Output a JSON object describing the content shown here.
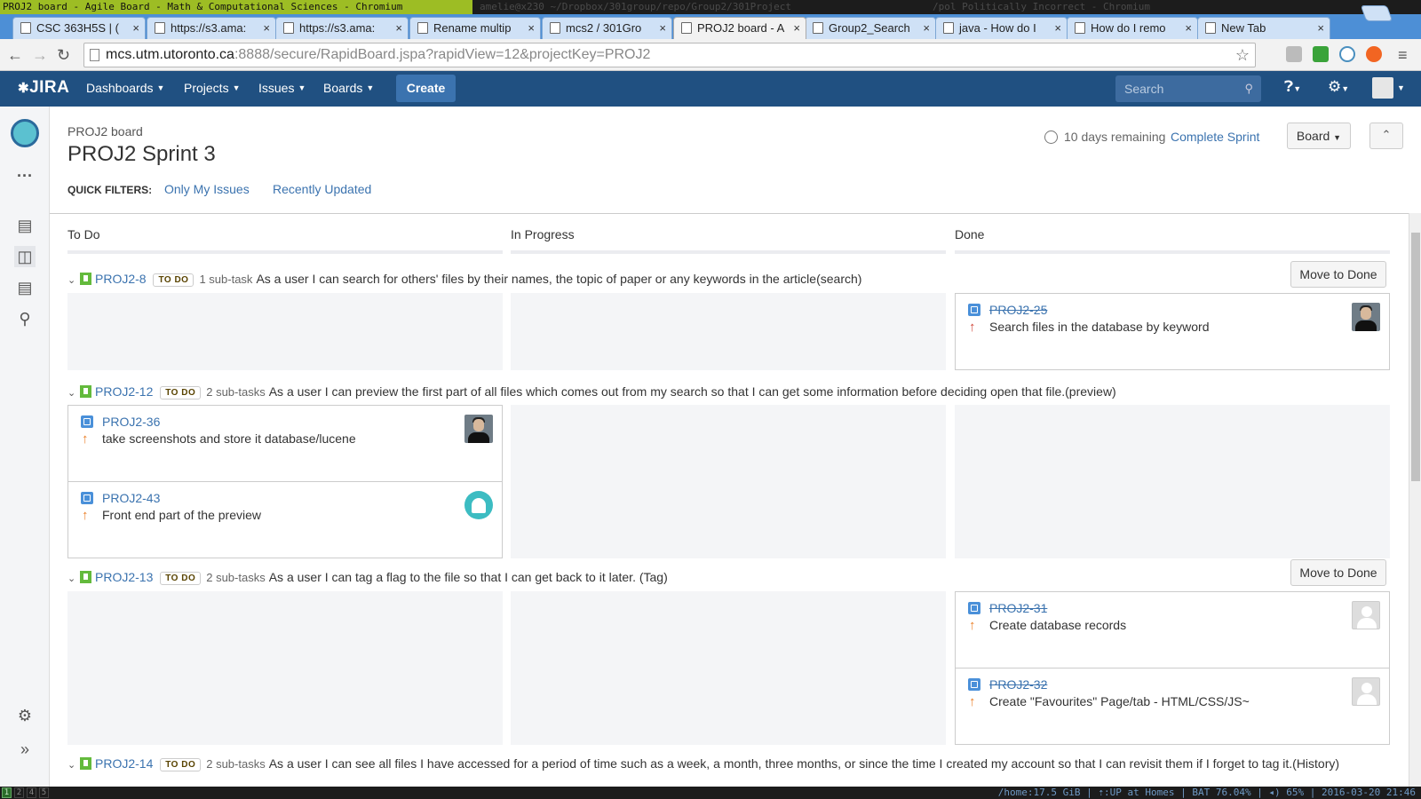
{
  "window": {
    "title": "PROJ2 board - Agile Board - Math & Computational Sciences - Chromium",
    "dim_title_1": "amelie@x230  ~/Dropbox/301group/repo/Group2/301Project",
    "dim_title_2": "/pol   Politically Incorrect - Chromium"
  },
  "browser": {
    "tabs": [
      {
        "label": "CSC 363H5S | (",
        "active": false
      },
      {
        "label": "https://s3.ama:",
        "active": false
      },
      {
        "label": "https://s3.ama:",
        "active": false
      },
      {
        "label": "Rename multip",
        "active": false
      },
      {
        "label": "mcs2 / 301Gro",
        "active": false
      },
      {
        "label": "PROJ2 board - A",
        "active": true
      },
      {
        "label": "Group2_Search",
        "active": false
      },
      {
        "label": "java - How do I",
        "active": false
      },
      {
        "label": "How do I remo",
        "active": false
      },
      {
        "label": "New Tab",
        "active": false
      }
    ],
    "close_glyph": "×",
    "url_host": "mcs.utm.utoronto.ca",
    "url_rest": ":8888/secure/RapidBoard.jspa?rapidView=12&projectKey=PROJ2",
    "back_icon": "arrow-left-icon",
    "forward_icon": "arrow-right-icon",
    "reload_icon": "reload-icon",
    "star_icon": "star-icon"
  },
  "jira": {
    "logo": "JIRA",
    "nav": [
      "Dashboards",
      "Projects",
      "Issues",
      "Boards"
    ],
    "create_label": "Create",
    "search_placeholder": "Search",
    "brand_color": "#205081",
    "link_color": "#3b73af"
  },
  "page": {
    "breadcrumb": "PROJ2 board",
    "title": "PROJ2 Sprint 3",
    "remaining": "10 days remaining",
    "complete_sprint": "Complete Sprint",
    "board_button": "Board",
    "quick_filters_label": "QUICK FILTERS:",
    "quick_filters": [
      "Only My Issues",
      "Recently Updated"
    ],
    "columns": [
      "To Do",
      "In Progress",
      "Done"
    ],
    "move_to_done": "Move to Done"
  },
  "swimlanes": [
    {
      "key": "PROJ2-8",
      "status": "TO DO",
      "subtasks": "1 sub-task",
      "summary": "As a user I can search for others' files by their names, the topic of paper or any keywords in the article(search)",
      "cards": [
        {
          "key": "PROJ2-25",
          "summary": "Search files in the database by keyword",
          "column": "Done",
          "done": true,
          "priority": "high",
          "avatar": "photo"
        }
      ]
    },
    {
      "key": "PROJ2-12",
      "status": "TO DO",
      "subtasks": "2 sub-tasks",
      "summary": "As a user I can preview the first part of all files which comes out from my search so that I can get some information before deciding open that file.(preview)",
      "cards": [
        {
          "key": "PROJ2-36",
          "summary": "take screenshots and store it database/lucene",
          "column": "To Do",
          "done": false,
          "priority": "medium",
          "avatar": "photo"
        },
        {
          "key": "PROJ2-43",
          "summary": "Front end part of the preview",
          "column": "To Do",
          "done": false,
          "priority": "medium",
          "avatar": "round"
        }
      ]
    },
    {
      "key": "PROJ2-13",
      "status": "TO DO",
      "subtasks": "2 sub-tasks",
      "summary": "As a user I can tag a flag to the file so that I can get back to it later. (Tag)",
      "cards": [
        {
          "key": "PROJ2-31",
          "summary": "Create database records",
          "column": "Done",
          "done": true,
          "priority": "medium",
          "avatar": "default"
        },
        {
          "key": "PROJ2-32",
          "summary": "Create \"Favourites\" Page/tab - HTML/CSS/JS~",
          "column": "Done",
          "done": true,
          "priority": "medium",
          "avatar": "default"
        }
      ]
    },
    {
      "key": "PROJ2-14",
      "status": "TO DO",
      "subtasks": "2 sub-tasks",
      "summary": "As a user I can see all files I have accessed for a period of time such as a week, a month, three months, or since the time I created my account so that I can revisit them if I forget to tag it.(History)",
      "cards": []
    }
  ],
  "statusbar": {
    "workspaces": [
      "1",
      "2",
      "4",
      "5"
    ],
    "right": "/home:17.5 GiB | ⇡:UP at Homes | BAT 76.04% | ◂) 65% | 2016-03-20 21:46"
  }
}
